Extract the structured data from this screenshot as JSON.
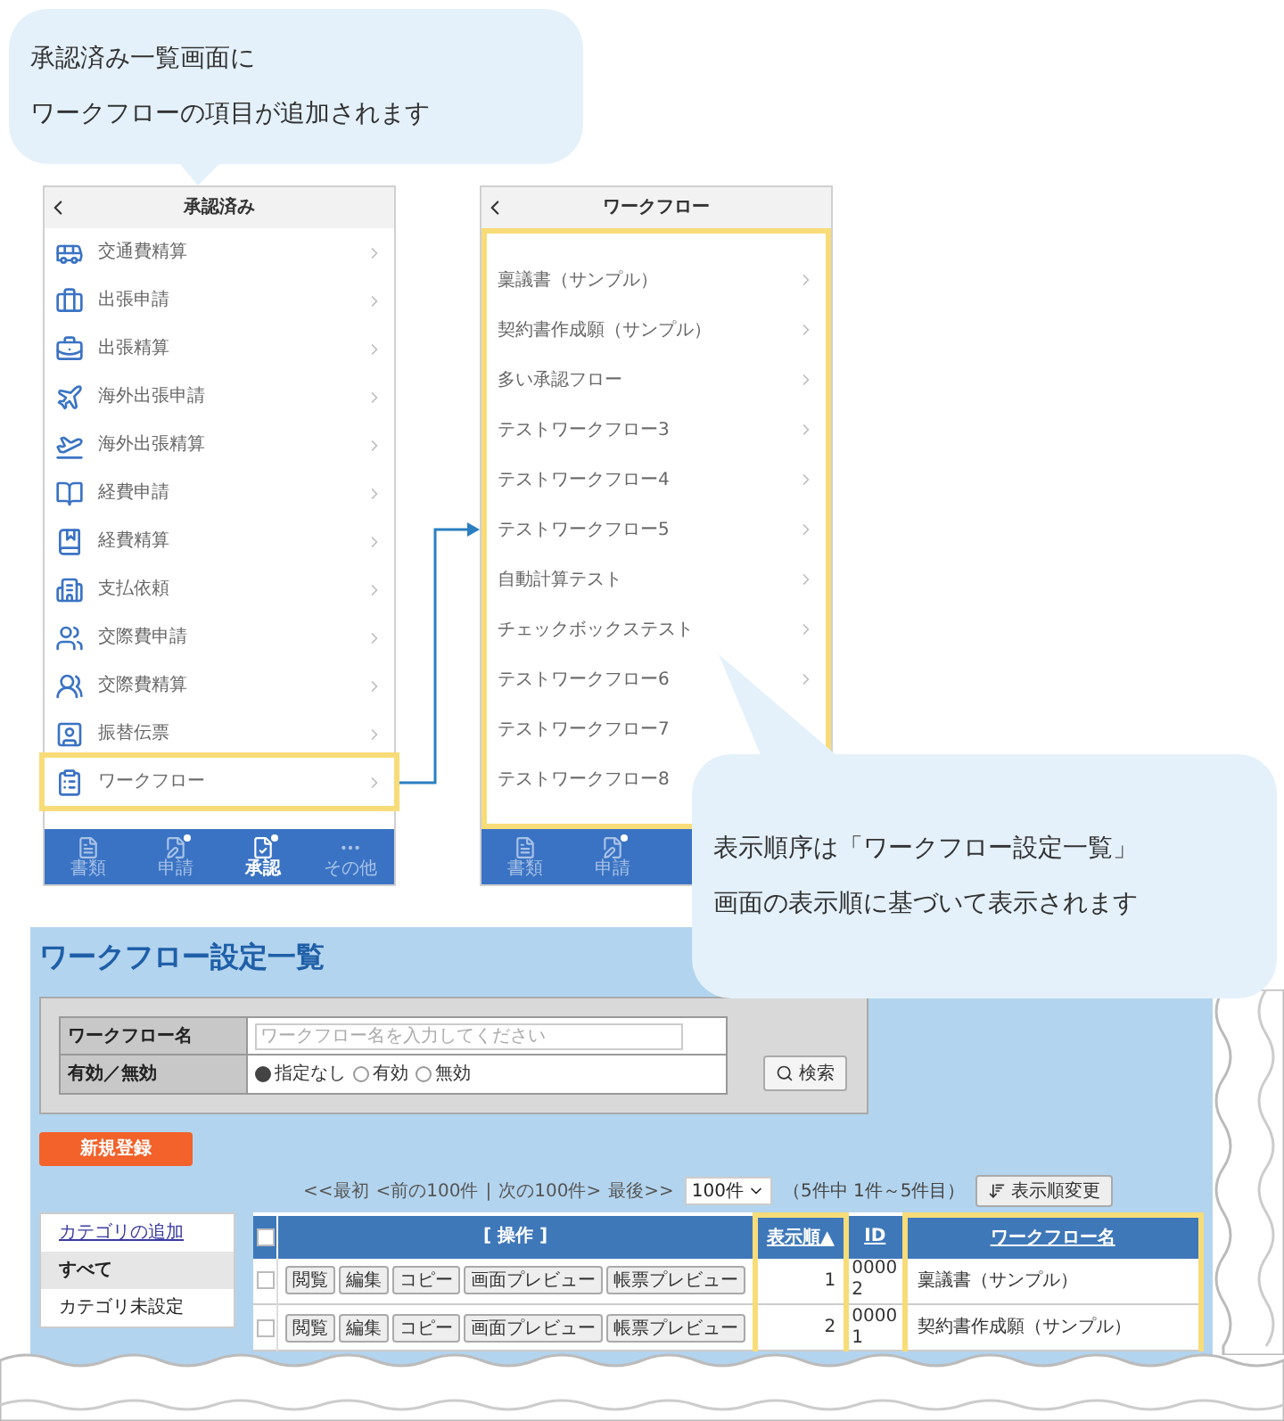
{
  "callouts": [
    {
      "lines": [
        "承認済み一覧画面に",
        "ワークフローの項目が追加されます"
      ]
    },
    {
      "lines": [
        "表示順序は「ワークフロー設定一覧」",
        "画面の表示順に基づいて表示されます"
      ]
    }
  ],
  "phones": [
    {
      "title": "承認済み",
      "highlight_list": false,
      "items": [
        {
          "label": "交通費精算",
          "highlighted": false,
          "chevron": true
        },
        {
          "label": "出張申請",
          "highlighted": false,
          "chevron": true
        },
        {
          "label": "出張精算",
          "highlighted": false,
          "chevron": true
        },
        {
          "label": "海外出張申請",
          "highlighted": false,
          "chevron": true
        },
        {
          "label": "海外出張精算",
          "highlighted": false,
          "chevron": true
        },
        {
          "label": "経費申請",
          "highlighted": false,
          "chevron": true
        },
        {
          "label": "経費精算",
          "highlighted": false,
          "chevron": true
        },
        {
          "label": "支払依頼",
          "highlighted": false,
          "chevron": true
        },
        {
          "label": "交際費申請",
          "highlighted": false,
          "chevron": true
        },
        {
          "label": "交際費精算",
          "highlighted": false,
          "chevron": true
        },
        {
          "label": "振替伝票",
          "highlighted": false,
          "chevron": true
        },
        {
          "label": "ワークフロー",
          "highlighted": true,
          "chevron": true
        }
      ],
      "tabs": [
        {
          "label": "書類",
          "selected": false,
          "badge": false
        },
        {
          "label": "申請",
          "selected": false,
          "badge": true
        },
        {
          "label": "承認",
          "selected": true,
          "badge": true
        },
        {
          "label": "その他",
          "selected": false,
          "badge": false
        }
      ]
    },
    {
      "title": "ワークフロー",
      "highlight_list": true,
      "items": [
        {
          "label": "稟議書（サンプル）",
          "highlighted": false,
          "chevron": true
        },
        {
          "label": "契約書作成願（サンプル）",
          "highlighted": false,
          "chevron": true
        },
        {
          "label": "多い承認フロー",
          "highlighted": false,
          "chevron": true
        },
        {
          "label": "テストワークフロー3",
          "highlighted": false,
          "chevron": true
        },
        {
          "label": "テストワークフロー4",
          "highlighted": false,
          "chevron": true
        },
        {
          "label": "テストワークフロー5",
          "highlighted": false,
          "chevron": true
        },
        {
          "label": "自動計算テスト",
          "highlighted": false,
          "chevron": true
        },
        {
          "label": "チェックボックステスト",
          "highlighted": false,
          "chevron": true
        },
        {
          "label": "テストワークフロー6",
          "highlighted": false,
          "chevron": true
        },
        {
          "label": "テストワークフロー7",
          "highlighted": false,
          "chevron": false
        },
        {
          "label": "テストワークフロー8",
          "highlighted": false,
          "chevron": false
        }
      ],
      "tabs": [
        {
          "label": "書類",
          "selected": false,
          "badge": false
        },
        {
          "label": "申請",
          "selected": false,
          "badge": true
        }
      ]
    }
  ],
  "admin": {
    "title": "ワークフロー設定一覧",
    "search": {
      "name_label": "ワークフロー名",
      "name_placeholder": "ワークフロー名を入力してください",
      "status_label": "有効／無効",
      "radios": [
        {
          "label": "指定なし",
          "selected": true
        },
        {
          "label": "有効",
          "selected": false
        },
        {
          "label": "無効",
          "selected": false
        }
      ],
      "button": "検索"
    },
    "new_button": "新規登録",
    "pager": [
      "<<最初",
      "<前の100件",
      "|",
      "次の100件>",
      "最後>>"
    ],
    "per_page": "100件",
    "count": "（5件中 1件～5件目）",
    "sort_button": "表示順変更",
    "categories": [
      {
        "label": "カテゴリの追加",
        "kind": "link",
        "selected": false
      },
      {
        "label": "すべて",
        "kind": "item",
        "selected": true
      },
      {
        "label": "カテゴリ未設定",
        "kind": "item",
        "selected": false
      }
    ],
    "table": {
      "select_all_checked": false,
      "columns": [
        {
          "label": "[ 操作 ]",
          "highlighted": false
        },
        {
          "label": "表示順▲",
          "highlighted": true
        },
        {
          "label": "ID",
          "highlighted": false
        },
        {
          "label": "ワークフロー名",
          "highlighted": true
        }
      ],
      "rows": [
        {
          "checked": false,
          "actions": [
            "閲覧",
            "編集",
            "コピー",
            "画面プレビュー",
            "帳票プレビュー"
          ],
          "order": "1",
          "id": "00002",
          "name": "稟議書（サンプル）"
        },
        {
          "checked": false,
          "actions": [
            "閲覧",
            "編集",
            "コピー",
            "画面プレビュー",
            "帳票プレビュー"
          ],
          "order": "2",
          "id": "00001",
          "name": "契約書作成願（サンプル）"
        }
      ]
    }
  }
}
